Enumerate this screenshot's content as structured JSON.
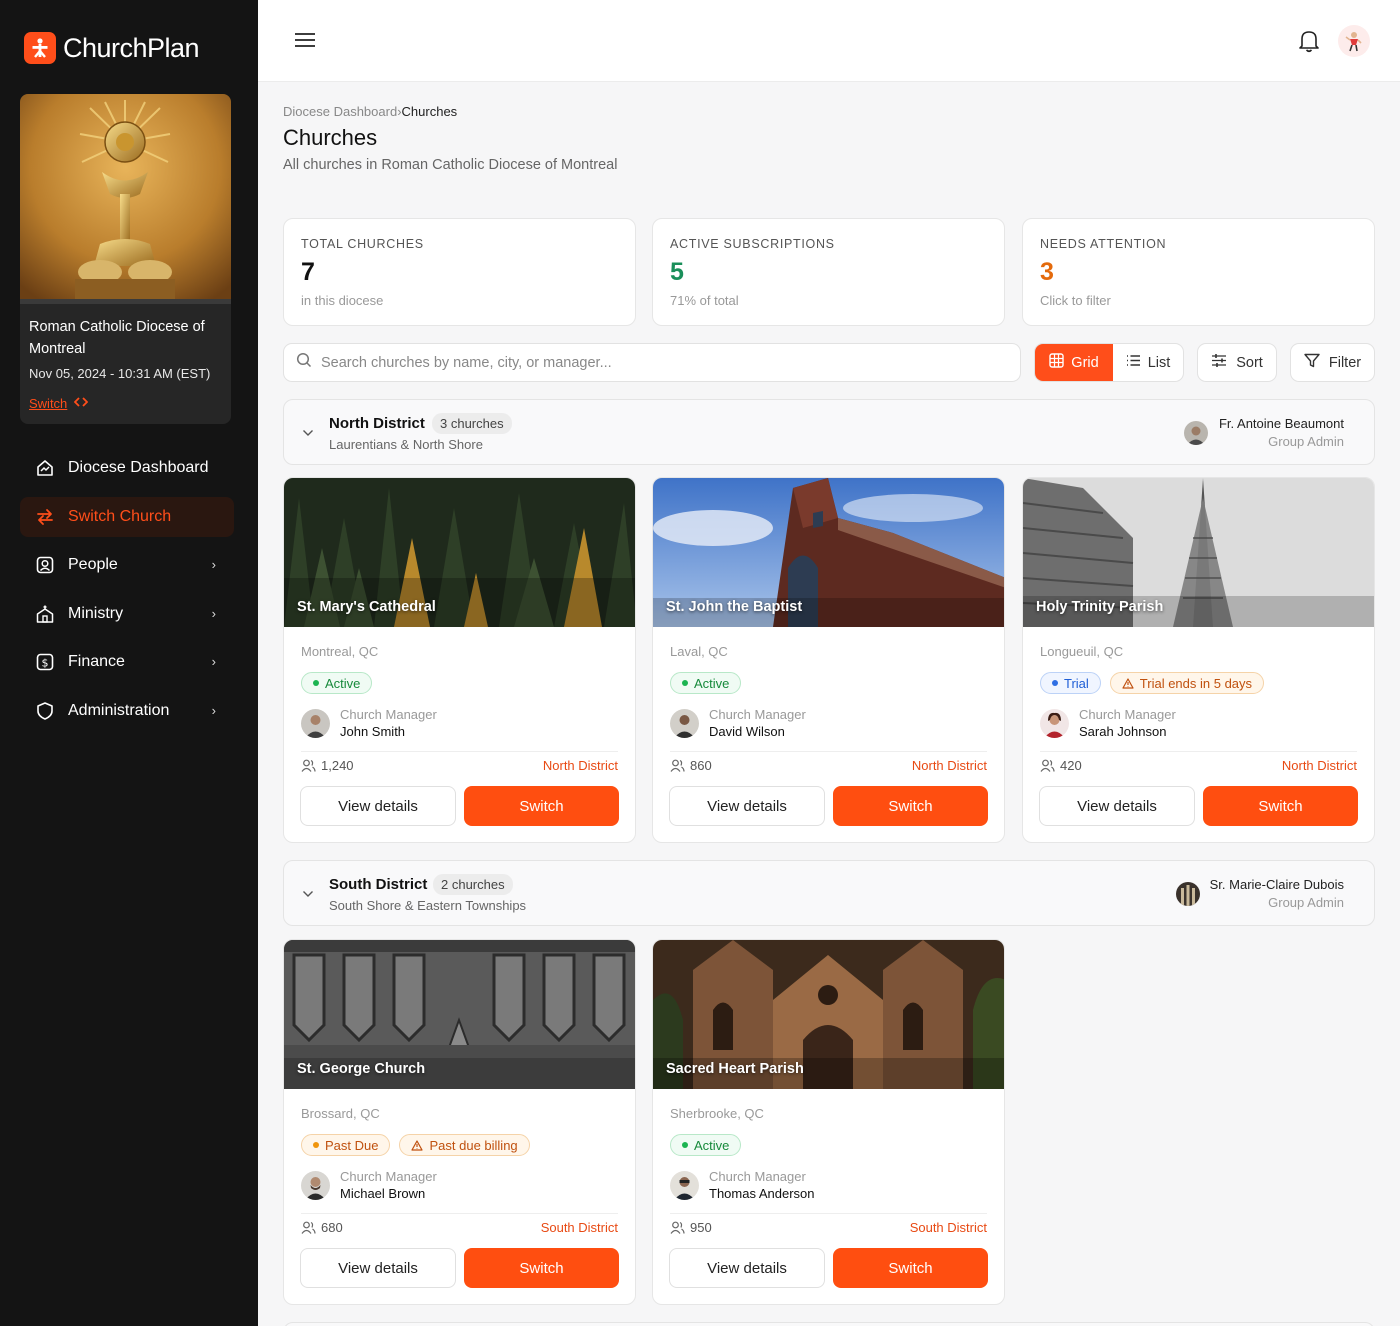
{
  "app": {
    "name": "ChurchPlan",
    "accent": "#ff4e1a"
  },
  "diocese": {
    "name": "Roman Catholic Diocese of Montreal",
    "datetime": "Nov 05, 2024 - 10:31 AM (EST)",
    "switch_label": "Switch",
    "switch_icon": "code-icon"
  },
  "nav": [
    {
      "label": "Diocese Dashboard",
      "icon": "dashboard-icon",
      "active": false
    },
    {
      "label": "Switch Church",
      "icon": "switch-arrows-icon",
      "active": true
    },
    {
      "label": "People",
      "icon": "people-icon",
      "active": false,
      "chevron": true
    },
    {
      "label": "Ministry",
      "icon": "church-icon",
      "active": false,
      "chevron": true
    },
    {
      "label": "Finance",
      "icon": "dollar-icon",
      "active": false,
      "chevron": true
    },
    {
      "label": "Administration",
      "icon": "shield-icon",
      "active": false,
      "chevron": true
    }
  ],
  "header": {
    "breadcrumb": {
      "parent": "Diocese Dashboard",
      "separator": "›",
      "current": "Churches"
    },
    "title": "Churches",
    "subtitle": "All churches in Roman Catholic Diocese of Montreal"
  },
  "stats": [
    {
      "label": "TOTAL CHURCHES",
      "value": "7",
      "sub": "in this diocese",
      "color": "#111111"
    },
    {
      "label": "ACTIVE SUBSCRIPTIONS",
      "value": "5",
      "sub": "71% of total",
      "color": "#1a8f5a"
    },
    {
      "label": "NEEDS ATTENTION",
      "value": "3",
      "sub": "Click to filter",
      "color": "#e46a0c"
    }
  ],
  "toolbar": {
    "search_placeholder": "Search churches by name, city, or manager...",
    "grid_label": "Grid",
    "list_label": "List",
    "sort_label": "Sort",
    "filter_label": "Filter"
  },
  "groups": [
    {
      "name": "North District",
      "count": "3 churches",
      "subtitle": "Laurentians & North Shore",
      "admin_name": "Fr. Antoine Beaumont",
      "admin_role": "Group Admin",
      "churches": [
        {
          "name": "St. Mary's Cathedral",
          "city": "Montreal, QC",
          "badges": [
            {
              "text": "Active",
              "kind": "active"
            }
          ],
          "manager_role": "Church Manager",
          "manager": "John Smith",
          "members": "1,240",
          "district": "North District",
          "view_label": "View details",
          "switch_label": "Switch"
        },
        {
          "name": "St. John the Baptist",
          "city": "Laval, QC",
          "badges": [
            {
              "text": "Active",
              "kind": "active"
            }
          ],
          "manager_role": "Church Manager",
          "manager": "David Wilson",
          "members": "860",
          "district": "North District",
          "view_label": "View details",
          "switch_label": "Switch"
        },
        {
          "name": "Holy Trinity Parish",
          "city": "Longueuil, QC",
          "badges": [
            {
              "text": "Trial",
              "kind": "trial"
            },
            {
              "text": "Trial ends in 5 days",
              "kind": "warn-alert"
            }
          ],
          "manager_role": "Church Manager",
          "manager": "Sarah Johnson",
          "members": "420",
          "district": "North District",
          "view_label": "View details",
          "switch_label": "Switch"
        }
      ]
    },
    {
      "name": "South District",
      "count": "2 churches",
      "subtitle": "South Shore & Eastern Townships",
      "admin_name": "Sr. Marie-Claire Dubois",
      "admin_role": "Group Admin",
      "churches": [
        {
          "name": "St. George Church",
          "city": "Brossard, QC",
          "badges": [
            {
              "text": "Past Due",
              "kind": "warn"
            },
            {
              "text": "Past due billing",
              "kind": "warn-alert"
            }
          ],
          "manager_role": "Church Manager",
          "manager": "Michael Brown",
          "members": "680",
          "district": "South District",
          "view_label": "View details",
          "switch_label": "Switch"
        },
        {
          "name": "Sacred Heart Parish",
          "city": "Sherbrooke, QC",
          "badges": [
            {
              "text": "Active",
              "kind": "active"
            }
          ],
          "manager_role": "Church Manager",
          "manager": "Thomas Anderson",
          "members": "950",
          "district": "South District",
          "view_label": "View details",
          "switch_label": "Switch"
        }
      ]
    }
  ]
}
